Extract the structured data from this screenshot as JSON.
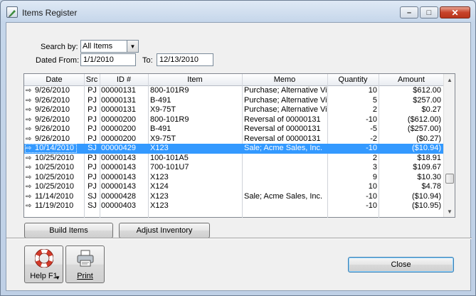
{
  "window": {
    "title": "Items Register"
  },
  "filters": {
    "search_by_label": "Search by:",
    "search_by_value": "All Items",
    "dated_from_label": "Dated From:",
    "dated_from_value": "1/1/2010",
    "to_label": "To:",
    "to_value": "12/13/2010"
  },
  "grid": {
    "columns": [
      "Date",
      "Src",
      "ID #",
      "Item",
      "Memo",
      "Quantity",
      "Amount"
    ],
    "selected_row": 6,
    "rows": [
      {
        "date": "9/26/2010",
        "src": "PJ",
        "id": "00000131",
        "item": "800-101R9",
        "memo": "Purchase; Alternative Vi",
        "qty": "10",
        "amount": "$612.00"
      },
      {
        "date": "9/26/2010",
        "src": "PJ",
        "id": "00000131",
        "item": "B-491",
        "memo": "Purchase; Alternative Vi",
        "qty": "5",
        "amount": "$257.00"
      },
      {
        "date": "9/26/2010",
        "src": "PJ",
        "id": "00000131",
        "item": "X9-75T",
        "memo": "Purchase; Alternative Vi",
        "qty": "2",
        "amount": "$0.27"
      },
      {
        "date": "9/26/2010",
        "src": "PJ",
        "id": "00000200",
        "item": "800-101R9",
        "memo": "Reversal of 00000131",
        "qty": "-10",
        "amount": "($612.00)"
      },
      {
        "date": "9/26/2010",
        "src": "PJ",
        "id": "00000200",
        "item": "B-491",
        "memo": "Reversal of 00000131",
        "qty": "-5",
        "amount": "($257.00)"
      },
      {
        "date": "9/26/2010",
        "src": "PJ",
        "id": "00000200",
        "item": "X9-75T",
        "memo": "Reversal of 00000131",
        "qty": "-2",
        "amount": "($0.27)"
      },
      {
        "date": "10/14/2010",
        "src": "SJ",
        "id": "00000429",
        "item": "X123",
        "memo": "Sale; Acme Sales, Inc.",
        "qty": "-10",
        "amount": "($10.94)"
      },
      {
        "date": "10/25/2010",
        "src": "PJ",
        "id": "00000143",
        "item": "100-101A5",
        "memo": "",
        "qty": "2",
        "amount": "$18.91"
      },
      {
        "date": "10/25/2010",
        "src": "PJ",
        "id": "00000143",
        "item": "700-101U7",
        "memo": "",
        "qty": "3",
        "amount": "$109.67"
      },
      {
        "date": "10/25/2010",
        "src": "PJ",
        "id": "00000143",
        "item": "X123",
        "memo": "",
        "qty": "9",
        "amount": "$10.30"
      },
      {
        "date": "10/25/2010",
        "src": "PJ",
        "id": "00000143",
        "item": "X124",
        "memo": "",
        "qty": "10",
        "amount": "$4.78"
      },
      {
        "date": "11/14/2010",
        "src": "SJ",
        "id": "00000428",
        "item": "X123",
        "memo": "Sale; Acme Sales, Inc.",
        "qty": "-10",
        "amount": "($10.94)"
      },
      {
        "date": "11/19/2010",
        "src": "SJ",
        "id": "00000403",
        "item": "X123",
        "memo": "",
        "qty": "-10",
        "amount": "($10.95)"
      }
    ]
  },
  "buttons": {
    "build_items": "Build Items",
    "adjust_inventory": "Adjust Inventory",
    "help": "Help F1",
    "print": "Print",
    "close": "Close"
  },
  "colors": {
    "selection": "#3399ff",
    "accent": "#c7432a"
  }
}
